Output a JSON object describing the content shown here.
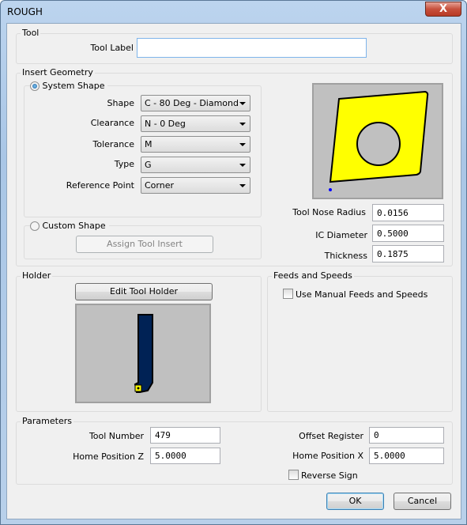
{
  "window": {
    "title": "ROUGH",
    "close": "X"
  },
  "tool": {
    "group": "Tool",
    "label": "Tool Label",
    "value": ""
  },
  "insert": {
    "group": "Insert Geometry",
    "system_shape": "System Shape",
    "system_selected": true,
    "fields": [
      {
        "label": "Shape",
        "value": "C - 80 Deg - Diamond"
      },
      {
        "label": "Clearance",
        "value": "N - 0 Deg"
      },
      {
        "label": "Tolerance",
        "value": "M"
      },
      {
        "label": "Type",
        "value": "G"
      },
      {
        "label": "Reference Point",
        "value": "Corner"
      }
    ],
    "custom_shape": "Custom Shape",
    "assign": "Assign Tool Insert",
    "nose_radius_label": "Tool Nose Radius",
    "nose_radius": "0.0156",
    "ic_label": "IC Diameter",
    "ic": "0.5000",
    "thickness_label": "Thickness",
    "thickness": "0.1875",
    "colors": {
      "insert": "#ffff00",
      "background": "#c0c0c0"
    }
  },
  "holder": {
    "group": "Holder",
    "edit": "Edit Tool Holder",
    "colors": {
      "holder": "#002255"
    }
  },
  "feeds": {
    "group": "Feeds and Speeds",
    "manual": "Use Manual Feeds and Speeds",
    "checked": false
  },
  "params": {
    "group": "Parameters",
    "tool_number_label": "Tool Number",
    "tool_number": "479",
    "home_z_label": "Home Position Z",
    "home_z": "5.0000",
    "offset_label": "Offset Register",
    "offset": "0",
    "home_x_label": "Home Position X",
    "home_x": "5.0000",
    "reverse": "Reverse Sign",
    "reverse_checked": false
  },
  "buttons": {
    "ok": "OK",
    "cancel": "Cancel"
  }
}
